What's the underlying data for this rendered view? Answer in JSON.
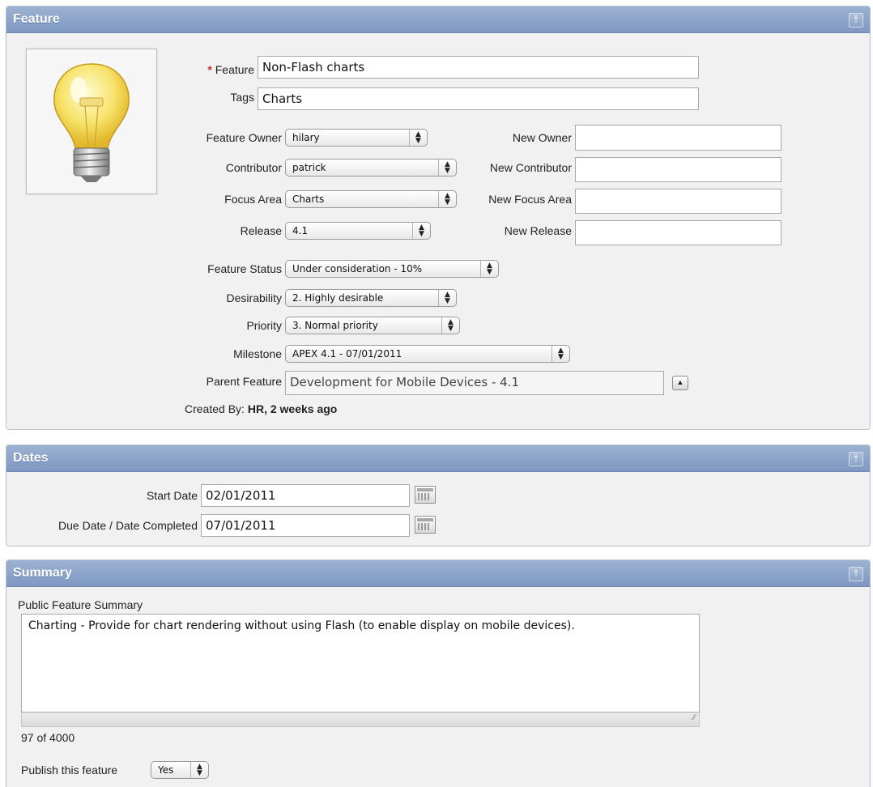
{
  "feature_region": {
    "title": "Feature",
    "collapse_icon": "arrow-up-bar-icon",
    "feature": {
      "required_mark": "*",
      "label": "Feature",
      "value": "Non-Flash charts"
    },
    "tags": {
      "label": "Tags",
      "value": "Charts"
    },
    "owner": {
      "label": "Feature Owner",
      "value": "hilary",
      "new_label": "New Owner",
      "new_value": ""
    },
    "contributor": {
      "label": "Contributor",
      "value": "patrick",
      "new_label": "New Contributor",
      "new_value": ""
    },
    "focus_area": {
      "label": "Focus Area",
      "value": "Charts",
      "new_label": "New Focus Area",
      "new_value": ""
    },
    "release": {
      "label": "Release",
      "value": "4.1",
      "new_label": "New Release",
      "new_value": ""
    },
    "status": {
      "label": "Feature Status",
      "value": "Under consideration - 10%"
    },
    "desirability": {
      "label": "Desirability",
      "value": "2. Highly desirable"
    },
    "priority": {
      "label": "Priority",
      "value": "3. Normal priority"
    },
    "milestone": {
      "label": "Milestone",
      "value": "APEX 4.1 - 07/01/2011"
    },
    "parent": {
      "label": "Parent Feature",
      "value": "Development for Mobile Devices - 4.1"
    },
    "created": {
      "label": "Created By:",
      "user": "HR",
      "sep": ",",
      "when": "2 weeks ago"
    }
  },
  "dates_region": {
    "title": "Dates",
    "start": {
      "label": "Start Date",
      "value": "02/01/2011"
    },
    "due": {
      "label": "Due Date / Date Completed",
      "value": "07/01/2011"
    }
  },
  "summary_region": {
    "title": "Summary",
    "label": "Public Feature Summary",
    "text": "Charting - Provide for chart rendering without using Flash (to enable display on mobile devices).",
    "counter": "97 of 4000",
    "publish_label": "Publish this feature",
    "publish_value": "Yes"
  },
  "colors": {
    "header": "#8ba3c9",
    "required": "#c0272d"
  }
}
